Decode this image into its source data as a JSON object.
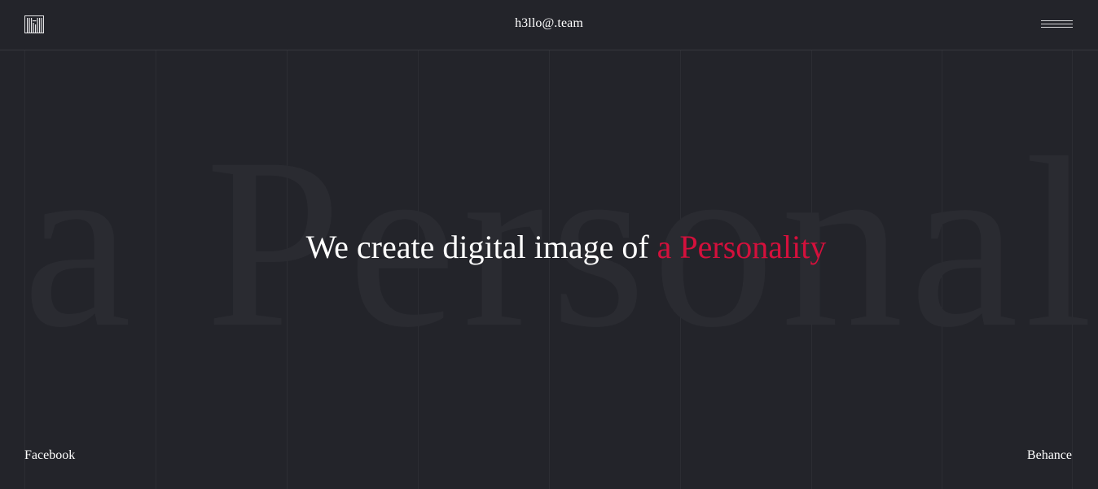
{
  "header": {
    "email": "h3llo@.team",
    "logo_icon": "striped-square-logo",
    "menu_icon": "hamburger-menu-icon"
  },
  "background": {
    "word": "a Personality"
  },
  "hero": {
    "text_main": "We create digital image of ",
    "text_accent": "a Personality"
  },
  "footer": {
    "left_link": "Facebook",
    "right_link": "Behance"
  },
  "colors": {
    "background": "#23242a",
    "accent": "#d4103c",
    "text": "#ffffff",
    "grid": "#2c2d33"
  }
}
